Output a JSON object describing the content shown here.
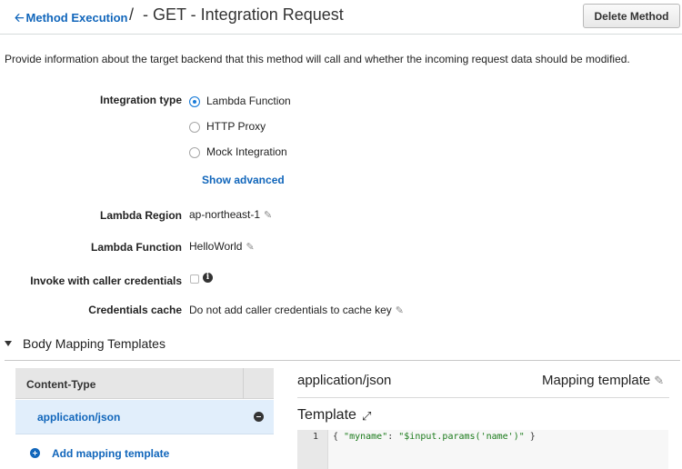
{
  "header": {
    "back_label": "Method Execution",
    "separator": "/",
    "title": "- GET - Integration Request",
    "delete_label": "Delete Method"
  },
  "description": "Provide information about the target backend that this method will call and whether the incoming request data should be modified.",
  "integration": {
    "label": "Integration type",
    "options": [
      {
        "label": "Lambda Function",
        "selected": true
      },
      {
        "label": "HTTP Proxy",
        "selected": false
      },
      {
        "label": "Mock Integration",
        "selected": false
      }
    ],
    "show_advanced": "Show advanced"
  },
  "fields": {
    "region": {
      "label": "Lambda Region",
      "value": "ap-northeast-1"
    },
    "function": {
      "label": "Lambda Function",
      "value": "HelloWorld"
    },
    "invoke": {
      "label": "Invoke with caller credentials",
      "checked": false
    },
    "cache": {
      "label": "Credentials cache",
      "value": "Do not add caller credentials to cache key"
    }
  },
  "body_mapping": {
    "section_title": "Body Mapping Templates",
    "column_header": "Content-Type",
    "content_types": [
      "application/json"
    ],
    "add_label": "Add mapping template",
    "selected_content_type": "application/json",
    "mapping_label": "Mapping template",
    "template_title": "Template",
    "editor": {
      "line_number": "1",
      "code_open": "{ ",
      "code_key": "\"myname\"",
      "code_colon": ": ",
      "code_value": "\"$input.params('name')\"",
      "code_close": " }"
    }
  },
  "colors": {
    "link": "#1166bb",
    "radio_selected": "#1a7cd9",
    "row_selected": "#e1eefb"
  },
  "icons": {
    "back": "arrow-left-icon",
    "edit": "pencil-icon",
    "info": "info-icon",
    "remove": "minus-circle-icon",
    "add": "plus-circle-icon",
    "expand": "expand-icon"
  }
}
